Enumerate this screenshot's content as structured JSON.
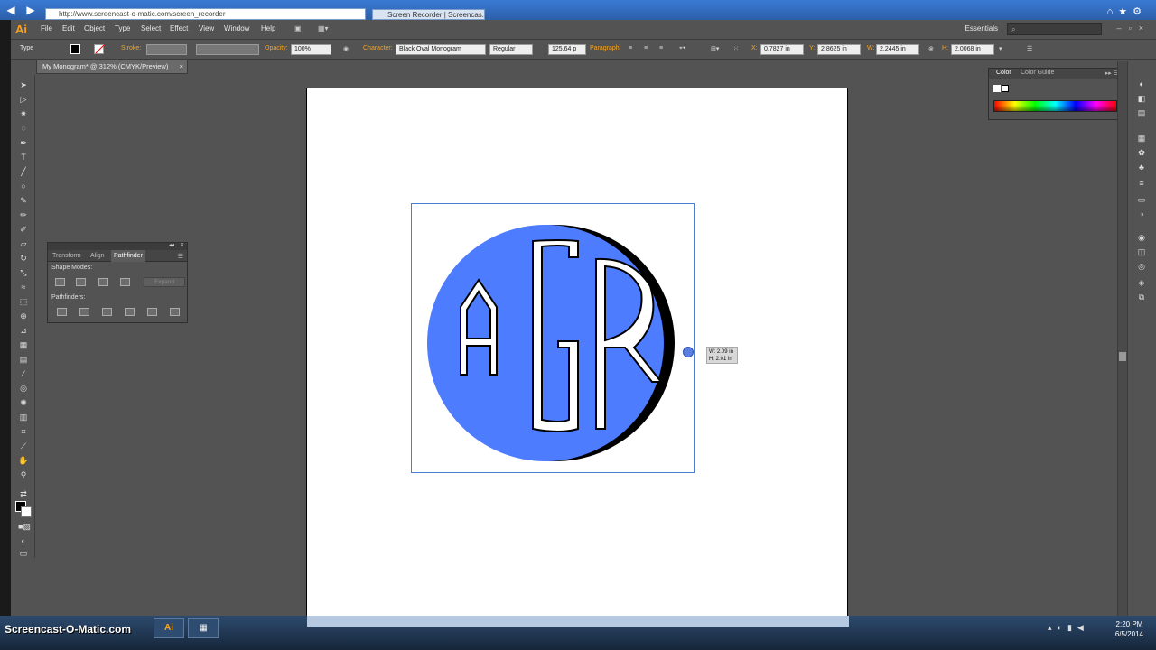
{
  "browser": {
    "url": "http://www.screencast-o-matic.com/screen_recorder",
    "tab_title": "Screen Recorder | Screencas..."
  },
  "menubar": {
    "logo": "Ai",
    "items": [
      "File",
      "Edit",
      "Object",
      "Type",
      "Select",
      "Effect",
      "View",
      "Window",
      "Help"
    ],
    "workspace": "Essentials"
  },
  "controlbar": {
    "type_label": "Type",
    "stroke_label": "Stroke:",
    "opacity_label": "Opacity:",
    "opacity_value": "100%",
    "character_label": "Character:",
    "font_name": "Black Oval Monogram",
    "font_style": "Regular",
    "font_size": "125.64 p",
    "paragraph_label": "Paragraph:",
    "x_label": "X:",
    "x_value": "0.7827 in",
    "y_label": "Y:",
    "y_value": "2.8625 in",
    "w_label": "W:",
    "w_value": "2.2445 in",
    "h_label": "H:",
    "h_value": "2.0068 in"
  },
  "document": {
    "tab_title": "My Monogram* @ 312% (CMYK/Preview)",
    "close": "×"
  },
  "monogram": {
    "letters": [
      "A",
      "G",
      "R"
    ],
    "fill_color": "#4d7cff",
    "shadow_color": "#000000"
  },
  "transform_tooltip": {
    "w": "W: 2.09 in",
    "h": "H: 2.01 in"
  },
  "pathfinder_panel": {
    "tabs": [
      "Transform",
      "Align",
      "Pathfinder"
    ],
    "active_tab": "Pathfinder",
    "shape_modes_label": "Shape Modes:",
    "pathfinders_label": "Pathfinders:",
    "expand_label": "Expand"
  },
  "color_panel": {
    "tabs": [
      "Color",
      "Color Guide"
    ],
    "active_tab": "Color"
  },
  "taskbar": {
    "brand": "Screencast-O-Matic.com",
    "ai_button": "Ai",
    "time": "2:20 PM",
    "date": "6/5/2014"
  }
}
